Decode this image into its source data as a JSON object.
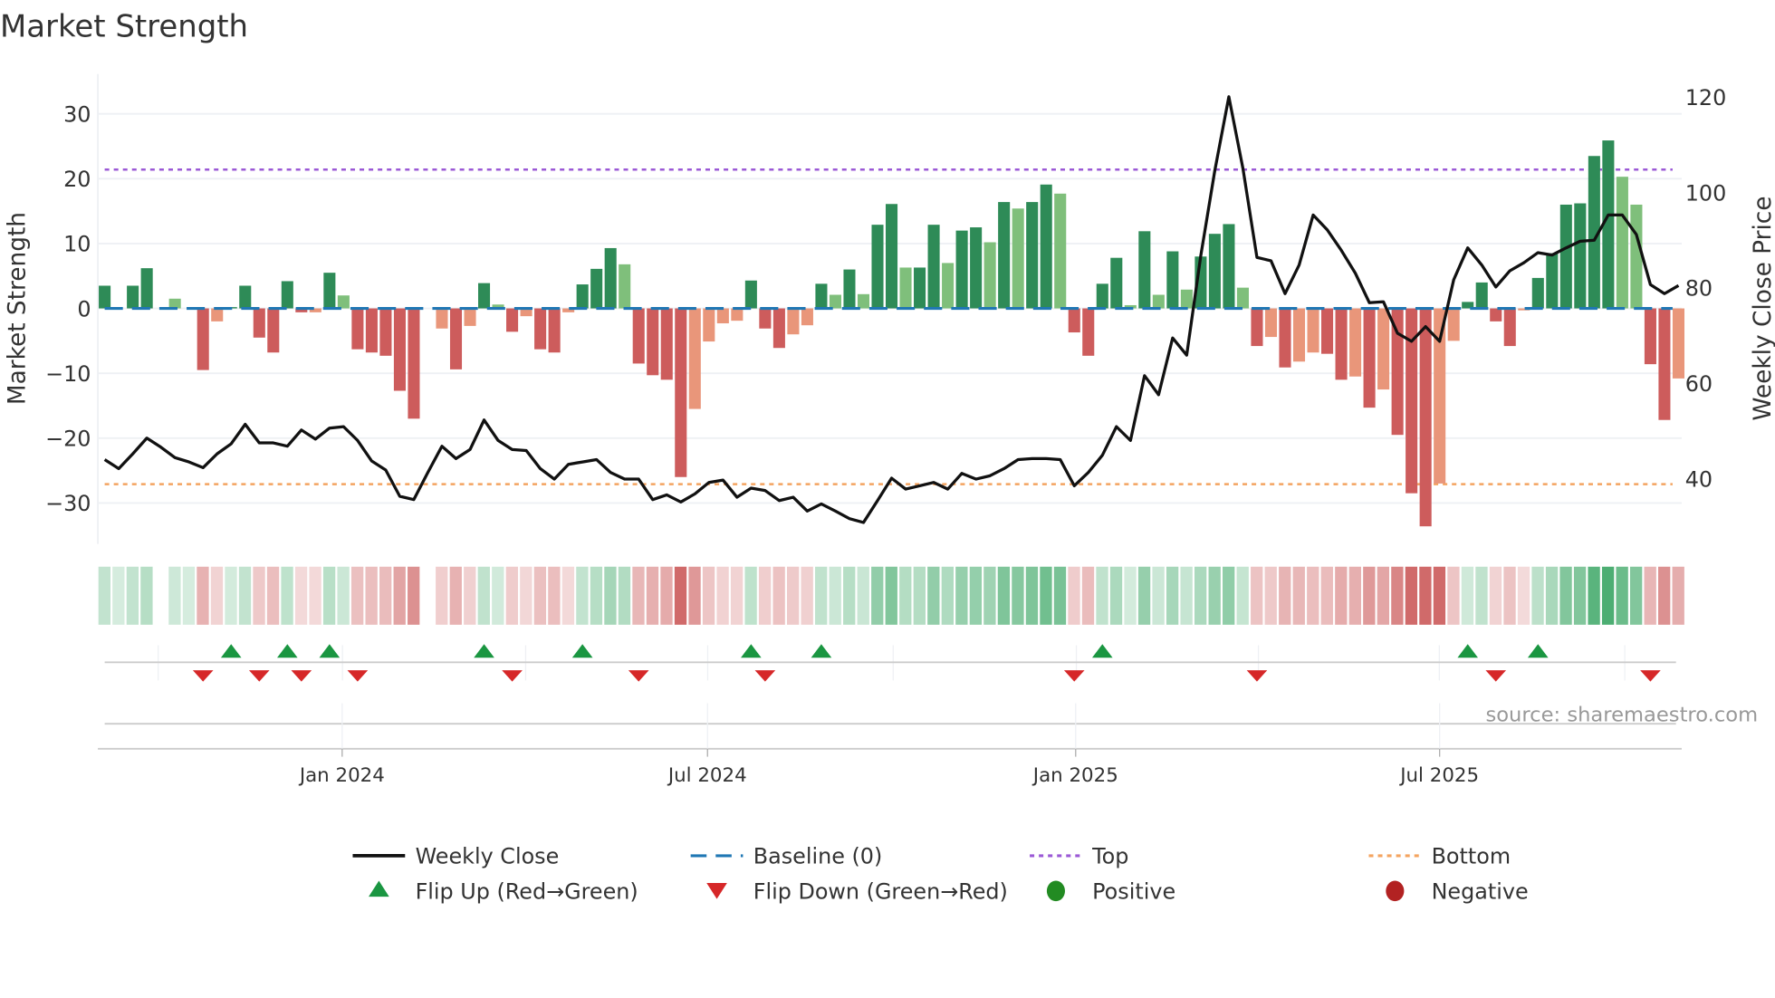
{
  "title": "Market Strength",
  "source": "source: sharemaestro.com",
  "colors": {
    "pos_strong": "#2e8b57",
    "pos_weak": "#7fbf7b",
    "neg_strong": "#cd5c5c",
    "neg_weak": "#e9967a",
    "close": "#111111",
    "baseline": "#1f77b4",
    "top": "#9b59d6",
    "bottom": "#f4a460",
    "flip_up": "#1a9641",
    "flip_down": "#d62728",
    "positive": "#228b22",
    "negative": "#b22222"
  },
  "legend": [
    {
      "key": "close",
      "label": "Weekly Close",
      "style": "line"
    },
    {
      "key": "baseline",
      "label": "Baseline (0)",
      "style": "dash"
    },
    {
      "key": "top",
      "label": "Top",
      "style": "dot"
    },
    {
      "key": "bottom",
      "label": "Bottom",
      "style": "dot"
    },
    {
      "key": "flip_up",
      "label": "Flip Up (Red→Green)",
      "style": "tri-up"
    },
    {
      "key": "flip_down",
      "label": "Flip Down (Green→Red)",
      "style": "tri-down"
    },
    {
      "key": "positive",
      "label": "Positive",
      "style": "circle"
    },
    {
      "key": "negative",
      "label": "Negative",
      "style": "circle"
    }
  ],
  "chart_data": {
    "type": "bar",
    "title": "Market Strength",
    "ylabel": "Market Strength",
    "y2label": "Weekly Close Price",
    "ylim": [
      -36,
      36
    ],
    "y2lim": [
      27,
      131
    ],
    "yticks": [
      30,
      20,
      10,
      0,
      -10,
      -20,
      -30
    ],
    "y2ticks": [
      120,
      100,
      80,
      40,
      60
    ],
    "x_unit": "week index",
    "x_ticks": [
      {
        "label": "Jan 2024",
        "week": 16.9
      },
      {
        "label": "Jul 2024",
        "week": 42.9
      },
      {
        "label": "Jan 2025",
        "week": 69.1
      },
      {
        "label": "Jul 2025",
        "week": 95.0
      }
    ],
    "grid": true,
    "top_level": 21.4,
    "bottom_level": -27.1,
    "strength": [
      3.5,
      0,
      3.5,
      6.2,
      null,
      1.5,
      0,
      -9.5,
      -2,
      0.2,
      3.5,
      -4.5,
      -6.8,
      4.2,
      -0.6,
      -0.6,
      5.5,
      2,
      -6.3,
      -6.8,
      -7.3,
      -12.7,
      -17,
      null,
      -3.1,
      -9.4,
      -2.7,
      3.9,
      0.6,
      -3.6,
      -1.2,
      -6.3,
      -6.8,
      -0.6,
      3.7,
      6.1,
      9.3,
      6.8,
      -8.5,
      -10.3,
      -11,
      -26,
      -15.5,
      -5.1,
      -2.3,
      -1.9,
      4.3,
      -3.1,
      -6.1,
      -4,
      -2.6,
      3.8,
      2.1,
      6,
      2.2,
      12.9,
      16.1,
      6.3,
      6.3,
      12.9,
      7,
      12,
      12.5,
      10.2,
      16.4,
      15.4,
      16.4,
      19.1,
      17.7,
      -3.7,
      -7.3,
      3.8,
      7.8,
      0.5,
      11.9,
      2.1,
      8.8,
      2.9,
      8,
      11.5,
      13,
      3.2,
      -5.8,
      -4.4,
      -9.1,
      -8.2,
      -6.8,
      -7,
      -11,
      -10.5,
      -15.3,
      -12.5,
      -19.5,
      -28.5,
      -33.6,
      -27,
      -5,
      1,
      4,
      -2,
      -5.8,
      -0.3,
      4.7,
      8.5,
      16,
      16.2,
      23.5,
      25.9,
      20.3,
      16,
      -8.6,
      -17.2,
      -10.8
    ],
    "tone": "DDDDxLDDLDDDDDDLDLDDDDDxLDLDLDLDDLDDDLDDDDLLLLDDDLLDLDLDDLDDLDDLDLDDLDDDDLDLDLDDDLDLDLLDDLDLDDDLLDDDDLDDDDDDLLDDL",
    "weekly_close": [
      44.0,
      42.1,
      45.2,
      48.5,
      46.6,
      44.4,
      43.5,
      42.3,
      45.2,
      47.3,
      51.4,
      47.5,
      47.5,
      46.8,
      50.2,
      48.3,
      50.6,
      50.9,
      48.0,
      43.7,
      41.8,
      36.3,
      35.6,
      41.3,
      46.8,
      44.2,
      46.1,
      52.3,
      48.0,
      46.1,
      45.9,
      42.1,
      39.9,
      43.0,
      43.5,
      44.0,
      41.3,
      39.9,
      39.9,
      35.6,
      36.6,
      35.1,
      36.8,
      39.2,
      39.7,
      36.1,
      38.0,
      37.5,
      35.4,
      36.1,
      33.2,
      34.7,
      33.2,
      31.6,
      30.8,
      35.4,
      40.1,
      37.8,
      38.5,
      39.2,
      37.8,
      41.1,
      39.9,
      40.6,
      42.1,
      44.0,
      44.2,
      44.2,
      44.0,
      38.5,
      41.3,
      44.9,
      50.9,
      48.0,
      61.6,
      57.6,
      69.5,
      65.9,
      86.7,
      104.6,
      120.1,
      105.1,
      86.4,
      85.7,
      78.8,
      84.8,
      95.3,
      92.2,
      87.9,
      83.1,
      76.9,
      77.1,
      70.5,
      68.8,
      71.9,
      68.8,
      81.7,
      88.4,
      84.8,
      80.2,
      83.6,
      85.3,
      87.4,
      86.9,
      88.4,
      89.8,
      90.0,
      95.3,
      95.3,
      91.2,
      80.7,
      78.8,
      80.5
    ],
    "flip_up_weeks": [
      9,
      13,
      16,
      27,
      34,
      46,
      51,
      71,
      97,
      102
    ],
    "flip_down_weeks": [
      7,
      11,
      14,
      18,
      29,
      38,
      47,
      69,
      82,
      99,
      110
    ]
  }
}
